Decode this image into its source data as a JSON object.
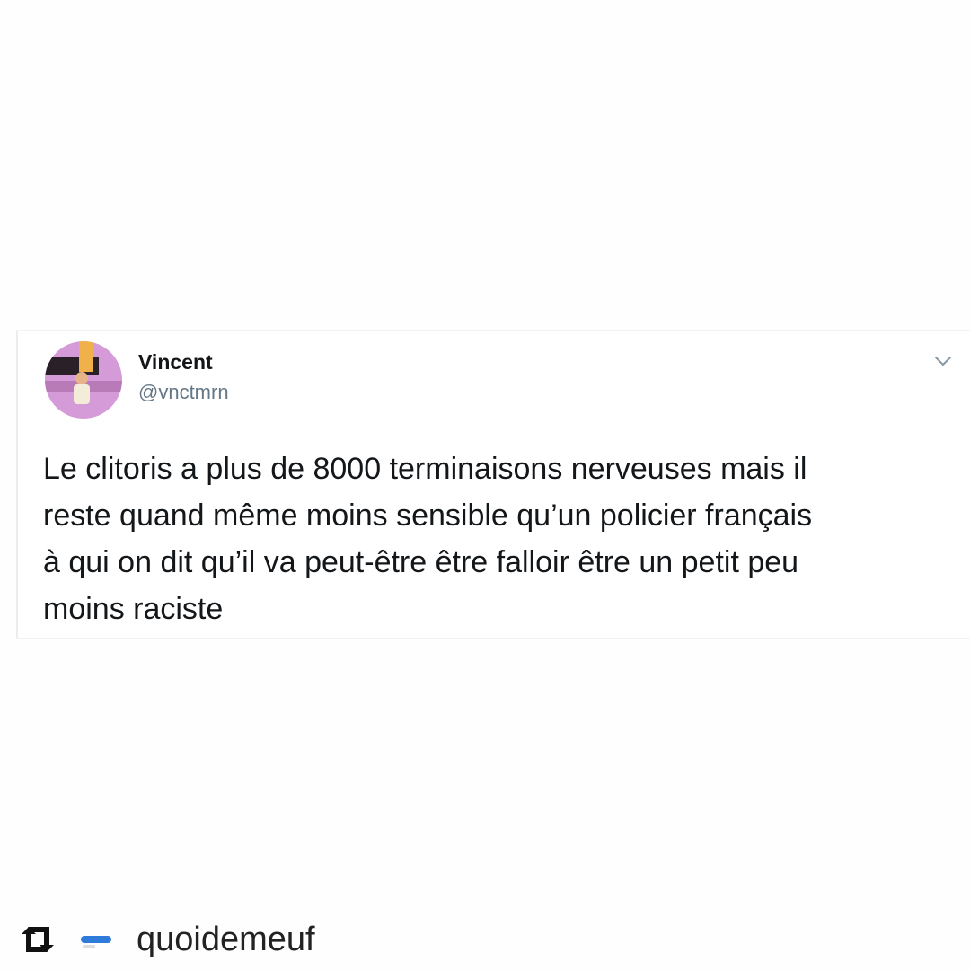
{
  "tweet": {
    "author_name": "Vincent",
    "author_handle": "@vnctmrn",
    "text": "Le clitoris a plus de 8000 terminaisons nerveuses mais il\nreste quand même moins sensible qu’un policier français\nà qui on dit qu’il va peut-être être falloir être un petit peu\nmoins raciste",
    "menu_icon": "chevron-down-icon"
  },
  "repost": {
    "icon": "repost-icon",
    "account_name": "quoidemeuf"
  },
  "colors": {
    "text_primary": "#14171a",
    "text_secondary": "#657786",
    "avatar_bg": "#d59ad8",
    "accent_blue": "#2f7bd9"
  }
}
